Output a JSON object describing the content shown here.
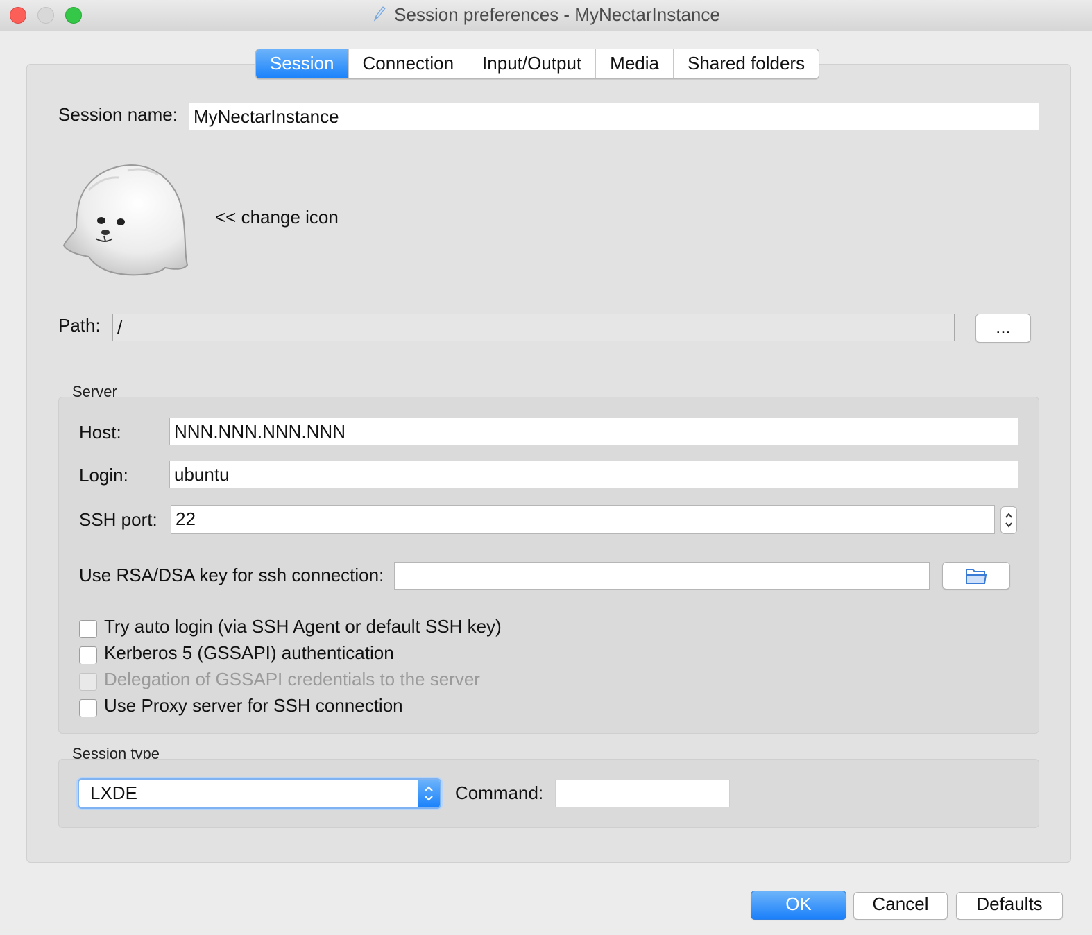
{
  "window": {
    "title": "Session preferences - MyNectarInstance"
  },
  "tabs": [
    {
      "label": "Session",
      "active": true
    },
    {
      "label": "Connection",
      "active": false
    },
    {
      "label": "Input/Output",
      "active": false
    },
    {
      "label": "Media",
      "active": false
    },
    {
      "label": "Shared folders",
      "active": false
    }
  ],
  "session": {
    "name_label": "Session name:",
    "name_value": "MyNectarInstance",
    "change_icon_label": "<< change icon",
    "path_label": "Path:",
    "path_value": "/",
    "browse_label": "..."
  },
  "server": {
    "group_label": "Server",
    "host_label": "Host:",
    "host_value": "NNN.NNN.NNN.NNN",
    "login_label": "Login:",
    "login_value": "ubuntu",
    "port_label": "SSH port:",
    "port_value": "22",
    "rsa_label": "Use RSA/DSA key for ssh connection:",
    "rsa_value": "",
    "checkboxes": [
      {
        "label": "Try auto login (via SSH Agent or default SSH key)",
        "checked": false,
        "enabled": true
      },
      {
        "label": "Kerberos 5 (GSSAPI) authentication",
        "checked": false,
        "enabled": true
      },
      {
        "label": "Delegation of GSSAPI credentials to the server",
        "checked": false,
        "enabled": false
      },
      {
        "label": "Use Proxy server for SSH connection",
        "checked": false,
        "enabled": true
      }
    ]
  },
  "session_type": {
    "group_label": "Session type",
    "selected": "LXDE",
    "command_label": "Command:",
    "command_value": ""
  },
  "footer": {
    "ok_label": "OK",
    "cancel_label": "Cancel",
    "defaults_label": "Defaults"
  },
  "colors": {
    "accent": "#1a82fb",
    "close": "#fc5f57",
    "minimize": "#d8d8d8",
    "zoom": "#34c748"
  }
}
